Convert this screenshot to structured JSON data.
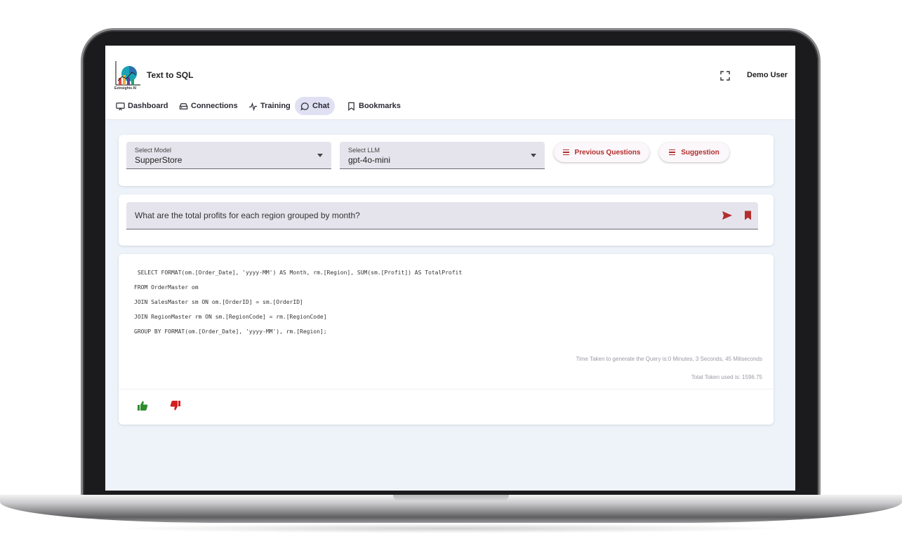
{
  "app": {
    "logo_text": "Ezinsights AI",
    "title": "Text to SQL",
    "user": "Demo User"
  },
  "nav": {
    "items": [
      {
        "label": "Dashboard",
        "icon": "monitor-icon"
      },
      {
        "label": "Connections",
        "icon": "database-icon"
      },
      {
        "label": "Training",
        "icon": "activity-icon"
      },
      {
        "label": "Chat",
        "icon": "chat-bubble-icon",
        "active": true
      },
      {
        "label": "Bookmarks",
        "icon": "bookmark-icon"
      }
    ]
  },
  "controls": {
    "model": {
      "label": "Select Model",
      "value": "SupperStore"
    },
    "llm": {
      "label": "Select LLM",
      "value": "gpt-4o-mini"
    },
    "previous_questions": "Previous Questions",
    "suggestion": "Suggestion"
  },
  "question": {
    "text": "What are the total profits for each region grouped by month?"
  },
  "result": {
    "sql_lines": [
      " SELECT FORMAT(om.[Order_Date], 'yyyy-MM') AS Month, rm.[Region], SUM(sm.[Profit]) AS TotalProfit",
      "FROM OrderMaster om",
      "JOIN SalesMaster sm ON om.[OrderID] = sm.[OrderID]",
      "JOIN RegionMaster rm ON sm.[RegionCode] = rm.[RegionCode]",
      "GROUP BY FORMAT(om.[Order_Date], 'yyyy-MM'), rm.[Region];"
    ],
    "time_taken": "Time Taken to generate the Query is:0 Minutes, 3 Seconds, 45 Miliseconds",
    "tokens": "Total Token used is: 1596.75"
  },
  "colors": {
    "accent_red": "#b42d2d",
    "thumb_up": "#2e8b2e",
    "thumb_down": "#d31f1f",
    "nav_active_bg": "#dfe1f3"
  }
}
